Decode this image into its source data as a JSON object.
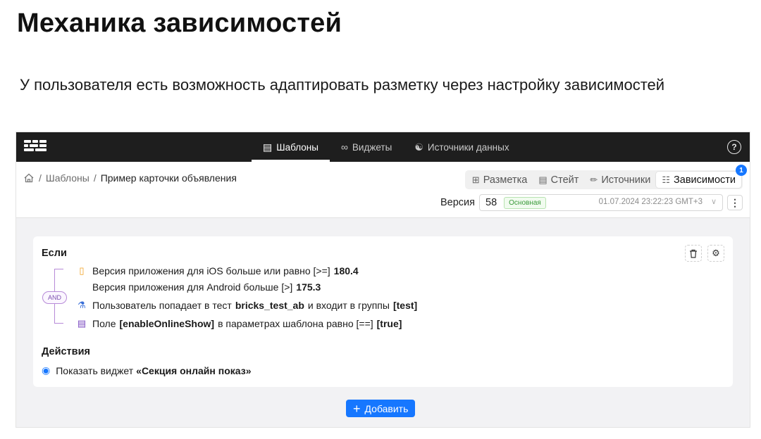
{
  "slide": {
    "title": "Механика зависимостей",
    "description": "У пользователя есть возможность адаптировать разметку через настройку зависимостей"
  },
  "app": {
    "nav": {
      "items": [
        {
          "label": "Шаблоны",
          "icon": "templates-icon",
          "active": true
        },
        {
          "label": "Виджеты",
          "icon": "widgets-icon",
          "active": false
        },
        {
          "label": "Источники данных",
          "icon": "datasource-icon",
          "active": false
        }
      ],
      "help": "?"
    },
    "breadcrumb": {
      "sep": "/",
      "items": [
        "Шаблоны",
        "Пример карточки объявления"
      ]
    },
    "view_tabs": {
      "items": [
        {
          "label": "Разметка",
          "icon": "layout-icon"
        },
        {
          "label": "Стейт",
          "icon": "state-icon"
        },
        {
          "label": "Источники",
          "icon": "sources-icon"
        },
        {
          "label": "Зависимости",
          "icon": "dependencies-icon",
          "active": true
        }
      ],
      "badge": "1"
    },
    "version": {
      "label": "Версия",
      "number": "58",
      "tag": "Основная",
      "date": "01.07.2024 23:22:23 GMT+3"
    },
    "rule": {
      "if_title": "Если",
      "operator": "AND",
      "conditions": [
        {
          "parts": [
            "Версия приложения для iOS больше или равно [>=]",
            "180.4"
          ]
        },
        {
          "parts": [
            "Версия приложения для Android больше [>]",
            "175.3"
          ]
        },
        {
          "parts": [
            "Пользователь попадает в тест",
            "bricks_test_ab",
            "и входит в группы",
            "[test]"
          ]
        },
        {
          "parts": [
            "Поле",
            "[enableOnlineShow]",
            "в параметрах шаблона равно [==]",
            "[true]"
          ]
        }
      ],
      "actions_title": "Действия",
      "action": {
        "text": "Показать виджет",
        "target": "«Секция онлайн показ»"
      }
    },
    "add_button": "Добавить"
  }
}
